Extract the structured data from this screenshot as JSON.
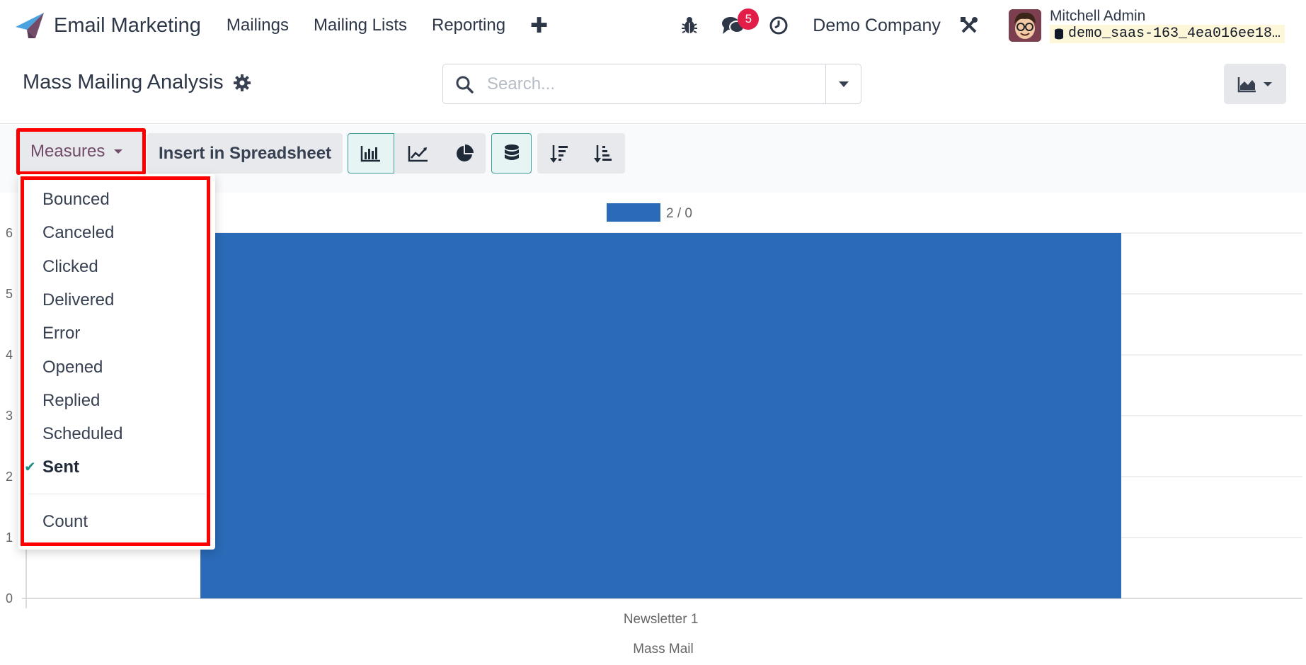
{
  "navbar": {
    "app_name": "Email Marketing",
    "menu": [
      "Mailings",
      "Mailing Lists",
      "Reporting"
    ],
    "plus_glyph": "✚",
    "icons": [
      "bug-icon",
      "chat-icon",
      "clock-icon",
      "tools-icon"
    ],
    "chat_badge": "5",
    "company": "Demo Company",
    "user_name": "Mitchell Admin",
    "database": "demo_saas-163_4ea016ee18…",
    "colors": {
      "brand_purple": "#714b67",
      "badge_red": "#e11d48"
    }
  },
  "control_panel": {
    "title": "Mass Mailing Analysis",
    "search_placeholder": "Search...",
    "search_value": ""
  },
  "toolbar": {
    "measures_label": "Measures",
    "insert_label": "Insert in Spreadsheet",
    "chart_type_buttons": [
      "bar-chart-icon",
      "line-chart-icon",
      "pie-chart-icon"
    ],
    "active_chart_type": "bar",
    "stacked_active": true,
    "sort_buttons": [
      "sort-descending-icon",
      "sort-ascending-icon"
    ]
  },
  "measures_dropdown": {
    "items": [
      "Bounced",
      "Canceled",
      "Clicked",
      "Delivered",
      "Error",
      "Opened",
      "Replied",
      "Scheduled",
      "Sent"
    ],
    "selected": "Sent",
    "count_label": "Count",
    "check_color": "#1f8f85"
  },
  "chart_data": {
    "type": "bar",
    "categories": [
      "Newsletter 1"
    ],
    "series": [
      {
        "name": "2 / 0",
        "values": [
          6
        ],
        "color": "#2a6ab7"
      }
    ],
    "xlabel": "Mass Mail",
    "ylabel": "",
    "ylim": [
      0,
      6
    ],
    "yticks": [
      "0",
      "1",
      "2",
      "3",
      "4",
      "5",
      "6"
    ],
    "grid": true,
    "legend_position": "top-center"
  }
}
